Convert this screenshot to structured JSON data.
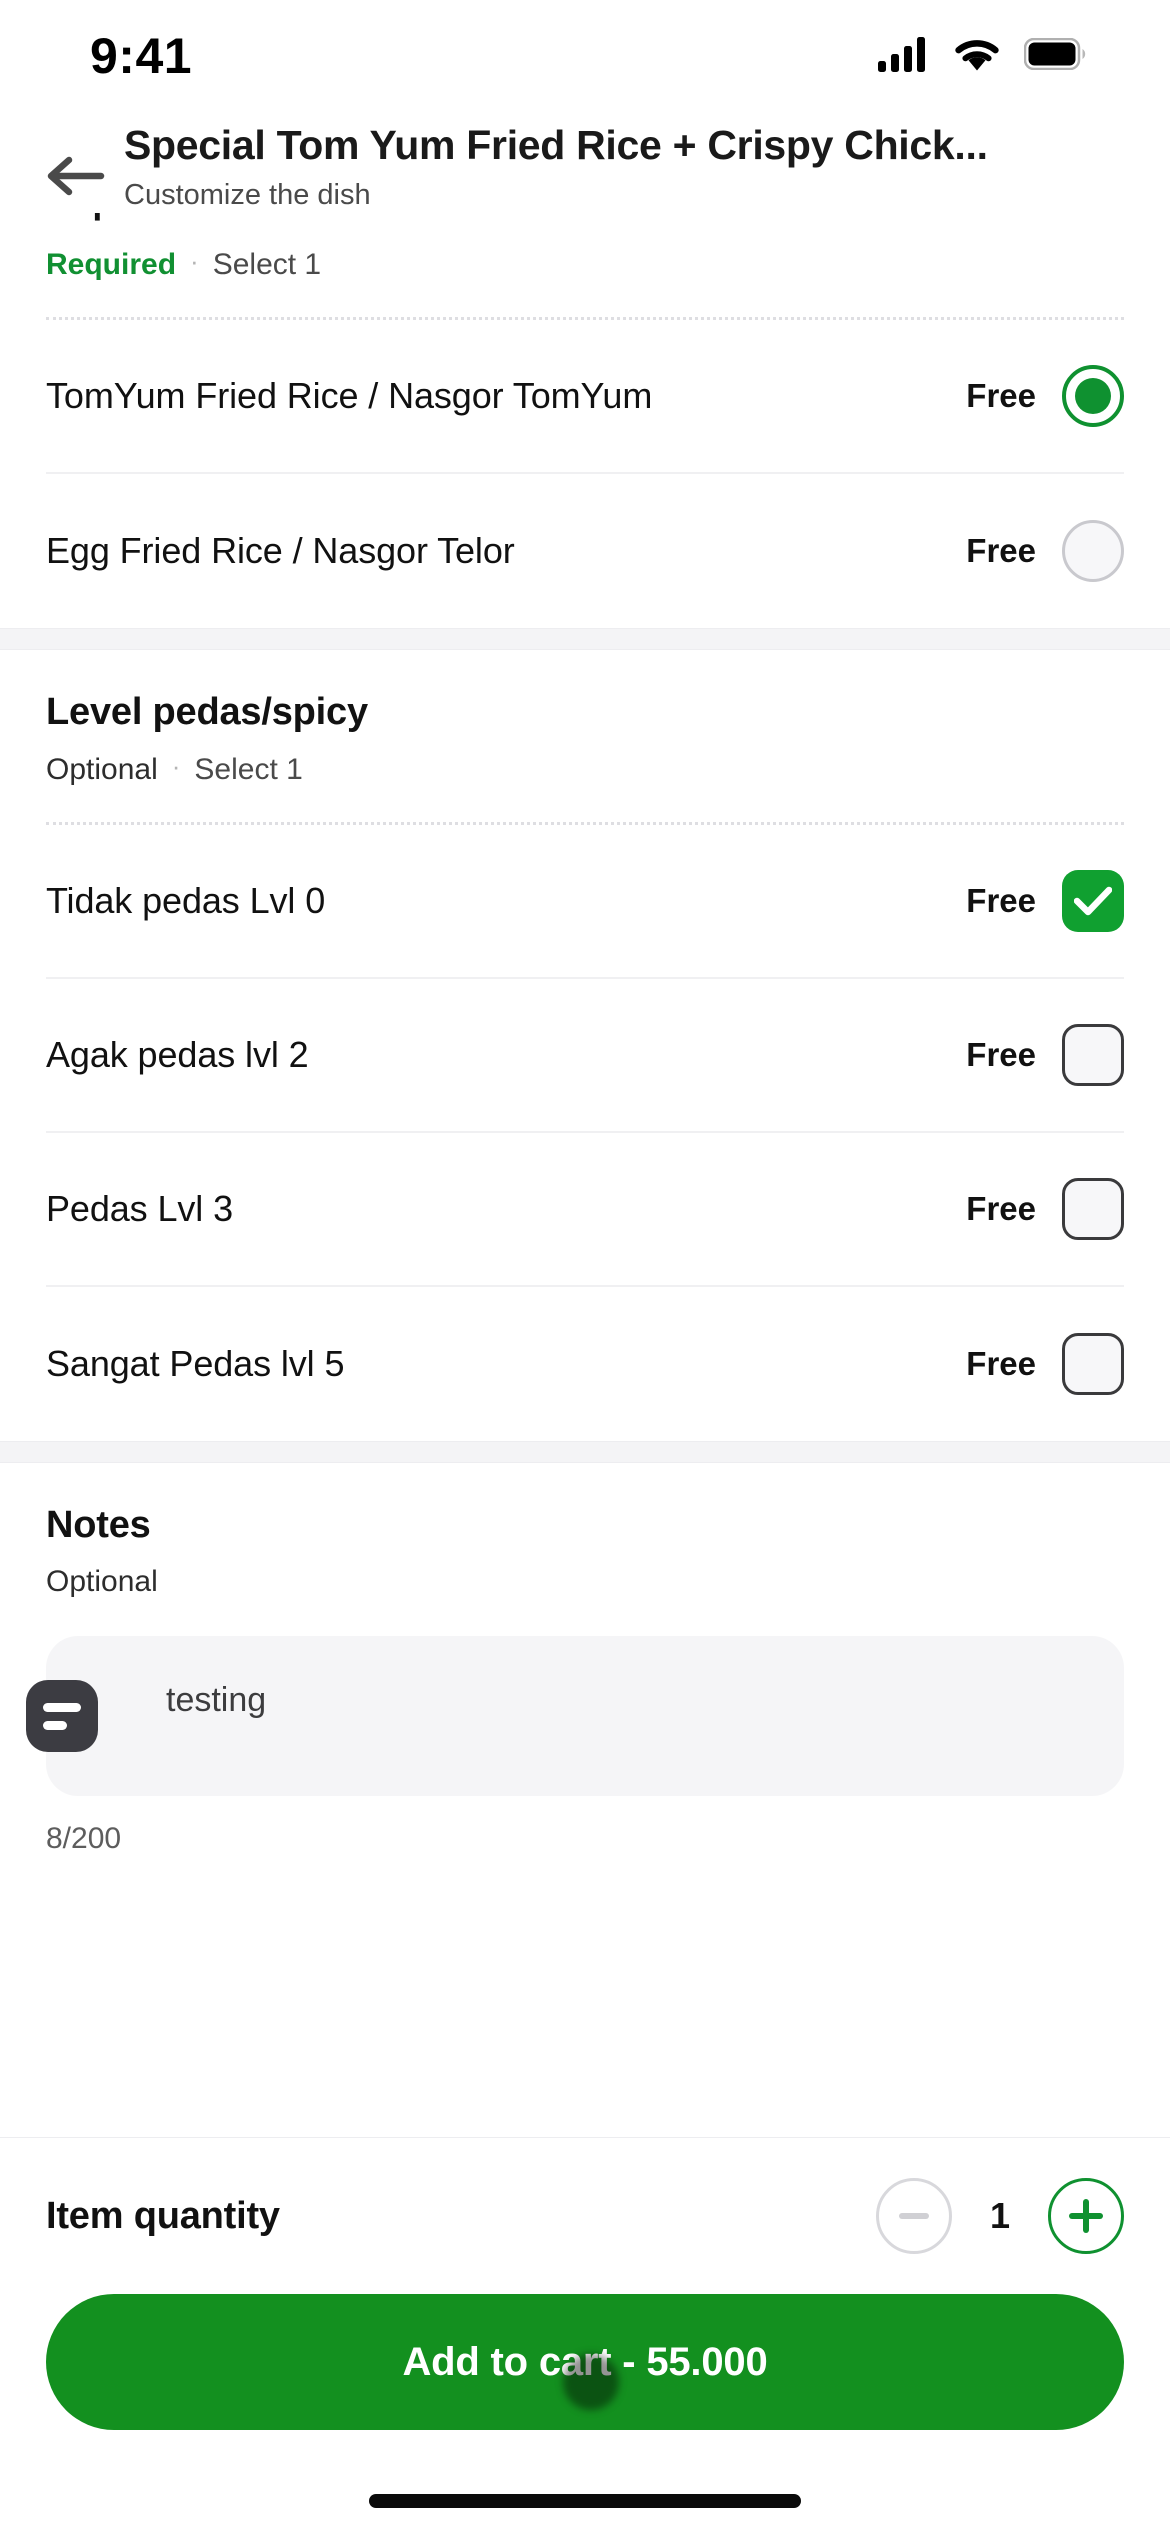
{
  "status_bar": {
    "time": "9:41",
    "icons": [
      "cellular-signal-icon",
      "wifi-icon",
      "battery-icon"
    ]
  },
  "header": {
    "back_icon": "arrow-left-icon",
    "title": "Special Tom Yum Fried Rice + Crispy Chick...",
    "subtitle": "Customize the dish"
  },
  "sections": [
    {
      "id": "rice-choice",
      "title_partial": "",
      "requirement": "Required",
      "separator": "·",
      "select_rule": "Select 1",
      "control": "radio",
      "options": [
        {
          "label": "TomYum Fried Rice / Nasgor TomYum",
          "price": "Free",
          "selected": true
        },
        {
          "label": "Egg Fried Rice / Nasgor Telor",
          "price": "Free",
          "selected": false
        }
      ]
    },
    {
      "id": "spicy-level",
      "title": "Level pedas/spicy",
      "requirement": "Optional",
      "separator": "·",
      "select_rule": "Select 1",
      "control": "checkbox",
      "options": [
        {
          "label": "Tidak pedas Lvl 0",
          "price": "Free",
          "selected": true
        },
        {
          "label": "Agak pedas lvl 2",
          "price": "Free",
          "selected": false
        },
        {
          "label": "Pedas Lvl 3",
          "price": "Free",
          "selected": false
        },
        {
          "label": "Sangat Pedas lvl 5",
          "price": "Free",
          "selected": false
        }
      ]
    }
  ],
  "notes": {
    "title": "Notes",
    "requirement": "Optional",
    "icon": "note-lines-icon",
    "value": "testing",
    "placeholder": "testing",
    "char_counter": "8/200"
  },
  "footer": {
    "quantity_label": "Item quantity",
    "decrement_icon": "minus-icon",
    "increment_icon": "plus-icon",
    "quantity_value": "1",
    "cta_label": "Add to cart - 55.000"
  },
  "colors": {
    "brand_green": "#13901f",
    "accent_green": "#0f9130",
    "check_green": "#10a030",
    "required_green": "#119032",
    "text_primary": "#111111",
    "text_secondary": "#5a5a5a",
    "surface": "#ffffff",
    "band": "#f4f4f6",
    "input_bg": "#f5f5f7"
  }
}
